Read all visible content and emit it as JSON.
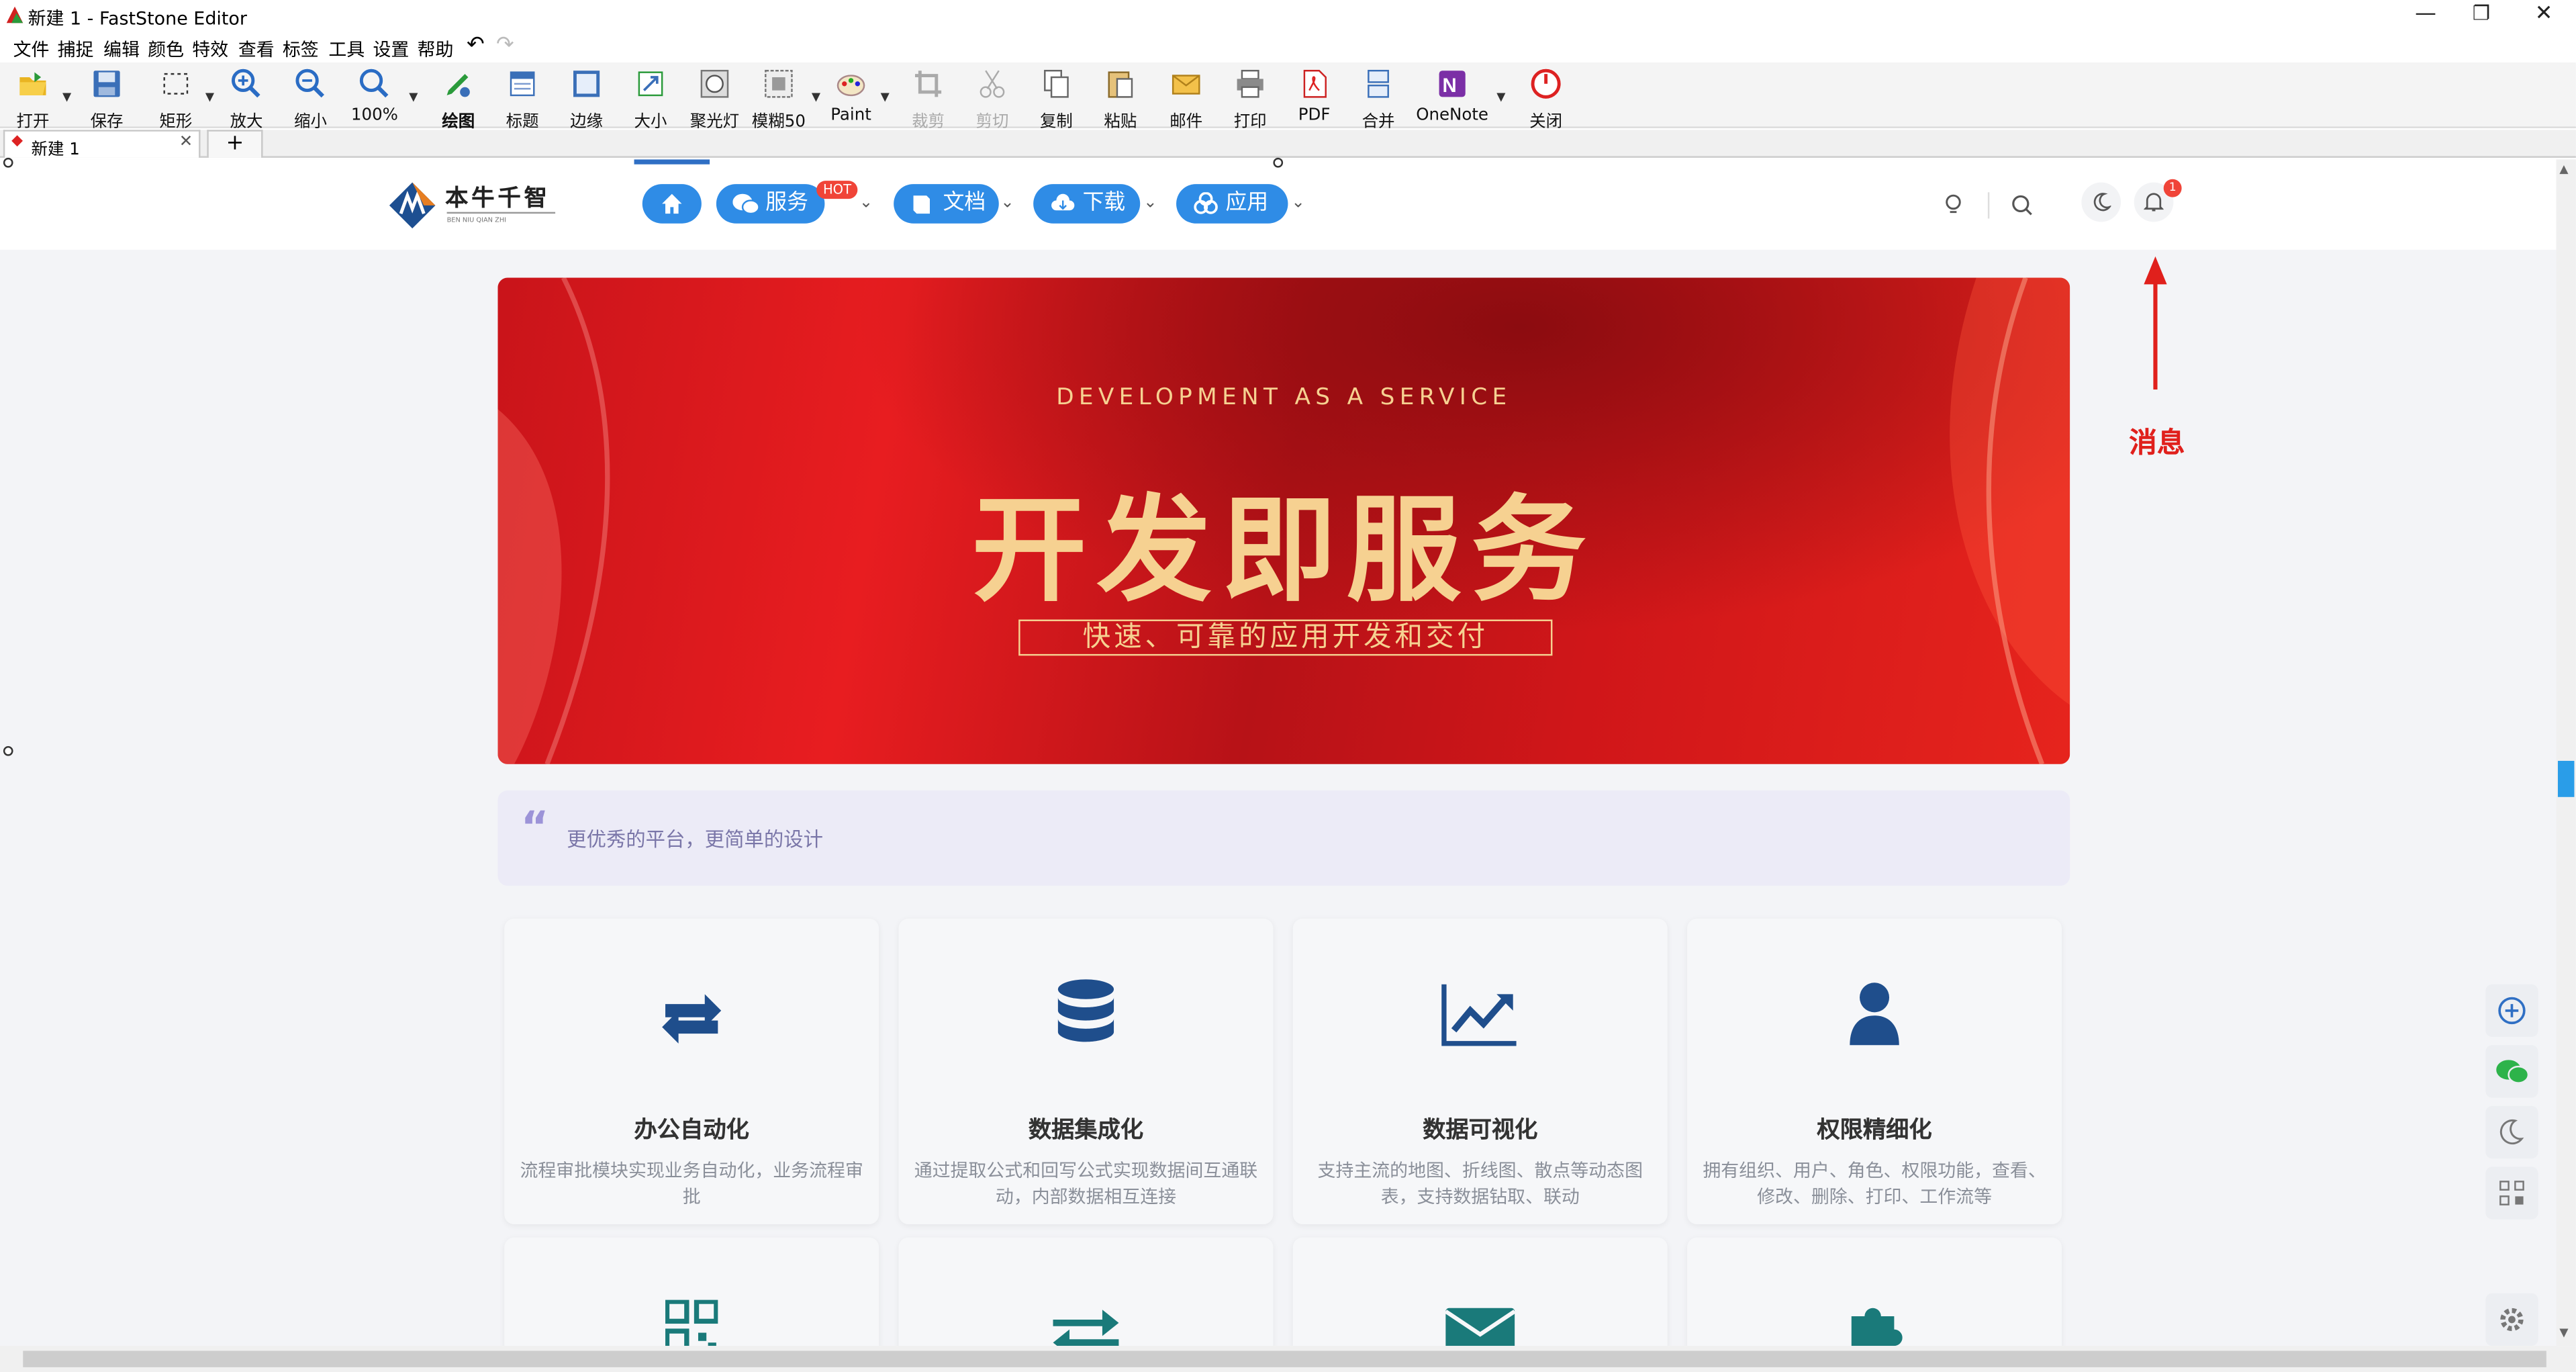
{
  "window": {
    "title": "新建 1 - FastStone Editor",
    "minimize": "—",
    "restore": "❐",
    "close": "✕"
  },
  "menu": [
    "文件",
    "捕捉",
    "编辑",
    "颜色",
    "特效",
    "查看",
    "标签",
    "工具",
    "设置",
    "帮助"
  ],
  "toolbar": [
    {
      "label": "打开",
      "icon": "open-folder-icon",
      "arrow": true
    },
    {
      "label": "保存",
      "icon": "save-icon"
    },
    {
      "label": "矩形",
      "icon": "rectangle-select-icon",
      "arrow": true
    },
    {
      "label": "放大",
      "icon": "zoom-in-icon"
    },
    {
      "label": "缩小",
      "icon": "zoom-out-icon"
    },
    {
      "label": "100%",
      "icon": "zoom-reset-icon",
      "arrow": true
    },
    {
      "label": "绘图",
      "icon": "draw-icon"
    },
    {
      "label": "标题",
      "icon": "caption-icon"
    },
    {
      "label": "边缘",
      "icon": "edge-icon"
    },
    {
      "label": "大小",
      "icon": "resize-icon"
    },
    {
      "label": "聚光灯",
      "icon": "spotlight-icon"
    },
    {
      "label": "模糊50",
      "icon": "blur-icon",
      "arrow": true
    },
    {
      "label": "Paint",
      "icon": "paint-icon",
      "arrow": true
    },
    {
      "label": "裁剪",
      "icon": "crop-icon",
      "disabled": true
    },
    {
      "label": "剪切",
      "icon": "cut-icon",
      "disabled": true
    },
    {
      "label": "复制",
      "icon": "copy-icon"
    },
    {
      "label": "粘贴",
      "icon": "paste-icon"
    },
    {
      "label": "邮件",
      "icon": "mail-icon"
    },
    {
      "label": "打印",
      "icon": "print-icon"
    },
    {
      "label": "PDF",
      "icon": "pdf-icon"
    },
    {
      "label": "合并",
      "icon": "merge-icon"
    },
    {
      "label": "OneNote",
      "icon": "onenote-icon",
      "arrow": true
    },
    {
      "label": "关闭",
      "icon": "power-icon"
    }
  ],
  "tabs": {
    "doc_tab": "新建 1",
    "close": "✕",
    "add": "+"
  },
  "site": {
    "logo_text": "本牛千智",
    "logo_sub": "BEN NIU QIAN ZHI",
    "nav": [
      {
        "label": "服务",
        "icon": "wechat-icon",
        "badge": "HOT"
      },
      {
        "label": "文档",
        "icon": "book-icon"
      },
      {
        "label": "下载",
        "icon": "cloud-download-icon"
      },
      {
        "label": "应用",
        "icon": "apps-icon"
      }
    ],
    "notification_count": "1",
    "banner": {
      "eyebrow": "DEVELOPMENT AS A SERVICE",
      "headline": "开发即服务",
      "tagline": "快速、可靠的应用开发和交付"
    },
    "quote": "更优秀的平台，更简单的设计",
    "features": [
      {
        "icon": "sync-arrows-icon",
        "title": "办公自动化",
        "desc": "流程审批模块实现业务自动化，业务流程审批"
      },
      {
        "icon": "database-icon",
        "title": "数据集成化",
        "desc": "通过提取公式和回写公式实现数据间互通联动，内部数据相互连接"
      },
      {
        "icon": "line-chart-icon",
        "title": "数据可视化",
        "desc": "支持主流的地图、折线图、散点等动态图表，支持数据钻取、联动"
      },
      {
        "icon": "user-icon",
        "title": "权限精细化",
        "desc": "拥有组织、用户、角色、权限功能，查看、修改、删除、打印、工作流等"
      }
    ],
    "annotation": "消息",
    "colors": {
      "accent": "#2f8ce6",
      "banner": "#d9161b",
      "gold": "#f6d191",
      "icon": "#1f4e8c",
      "annotation": "#e0201c"
    }
  }
}
